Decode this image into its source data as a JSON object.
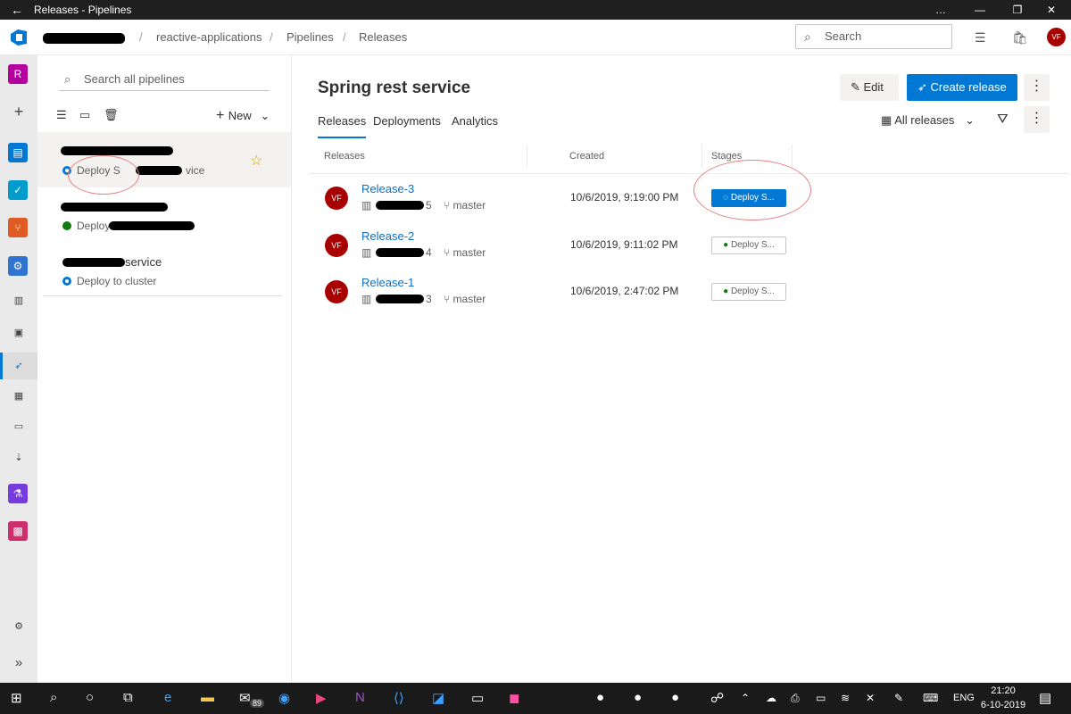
{
  "window": {
    "title": "Releases - Pipelines",
    "minimize": "…",
    "close": "✕"
  },
  "breadcrumb": {
    "project": "reactive-applications",
    "section": "Pipelines",
    "page": "Releases",
    "separator": "/"
  },
  "header": {
    "search_placeholder": "Search",
    "user_initials": "VF"
  },
  "leftnav": {
    "org_initial": "R"
  },
  "pipelines_panel": {
    "search_placeholder": "Search all pipelines",
    "new_label": "New",
    "items": [
      {
        "status": "Deploy S",
        "status_tail": "vice",
        "status_color": "#0078d4",
        "starred": true
      },
      {
        "status": "Deploy",
        "status_color": "#107c10"
      },
      {
        "name_tail": "service",
        "status": "Deploy to cluster",
        "status_color": "#0078d4"
      }
    ]
  },
  "main": {
    "title": "Spring rest service",
    "tabs": [
      "Releases",
      "Deployments",
      "Analytics"
    ],
    "edit_label": "Edit",
    "create_label": "Create release",
    "filter_label": "All releases",
    "columns": {
      "releases": "Releases",
      "created": "Created",
      "stages": "Stages"
    },
    "rows": [
      {
        "avatar": "VF",
        "name": "Release-3",
        "build_tail": "5",
        "branch": "master",
        "created": "10/6/2019, 9:19:00 PM",
        "stage": "Deploy S...",
        "stage_state": "running"
      },
      {
        "avatar": "VF",
        "name": "Release-2",
        "build_tail": "4",
        "branch": "master",
        "created": "10/6/2019, 9:11:02 PM",
        "stage": "Deploy S...",
        "stage_state": "success"
      },
      {
        "avatar": "VF",
        "name": "Release-1",
        "build_tail": "3",
        "branch": "master",
        "created": "10/6/2019, 2:47:02 PM",
        "stage": "Deploy S...",
        "stage_state": "success"
      }
    ]
  },
  "taskbar": {
    "mail_badge": "89",
    "lang": "ENG",
    "time": "21:20",
    "date": "6-10-2019"
  },
  "colors": {
    "accent": "#0078d4",
    "success": "#107c10",
    "avatar": "#a80000"
  }
}
